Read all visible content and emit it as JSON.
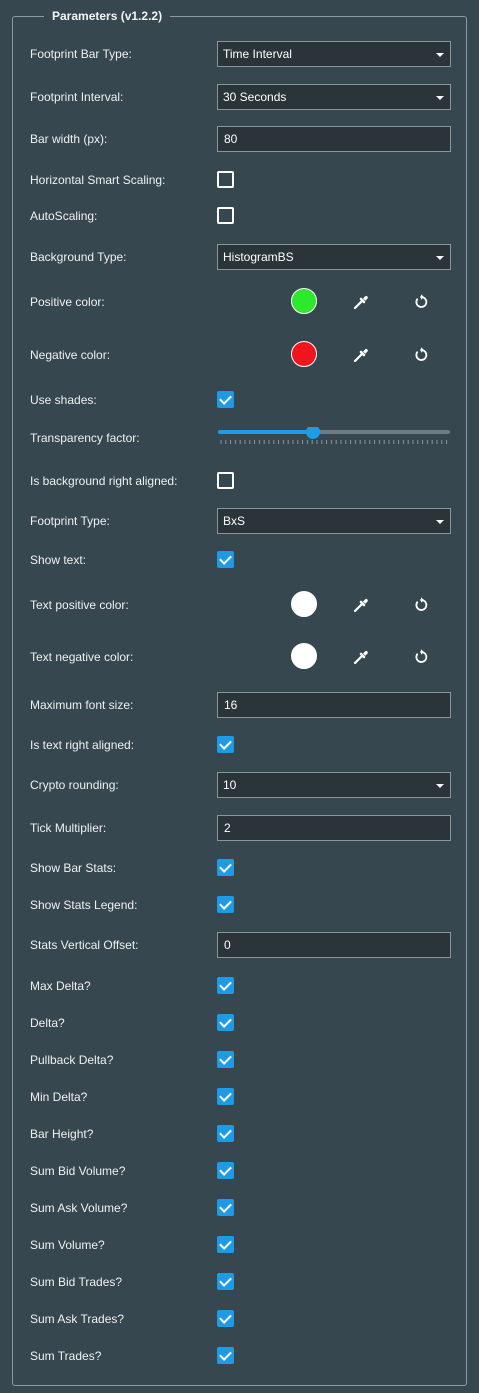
{
  "panel": {
    "title": "Parameters (v1.2.2)"
  },
  "fields": [
    {
      "label": "Footprint Bar Type:",
      "type": "select",
      "value": "Time Interval"
    },
    {
      "label": "Footprint Interval:",
      "type": "select",
      "value": "30 Seconds"
    },
    {
      "label": "Bar width (px):",
      "type": "input",
      "value": "80"
    },
    {
      "label": "Horizontal Smart Scaling:",
      "type": "checkbox",
      "checked": false
    },
    {
      "label": "AutoScaling:",
      "type": "checkbox",
      "checked": false
    },
    {
      "label": "Background Type:",
      "type": "select",
      "value": "HistogramBS"
    },
    {
      "label": "Positive color:",
      "type": "color",
      "color": "#2ee82e"
    },
    {
      "label": "Negative color:",
      "type": "color",
      "color": "#f0141e"
    },
    {
      "label": "Use shades:",
      "type": "checkbox",
      "checked": true
    },
    {
      "label": "Transparency factor:",
      "type": "slider",
      "value": 0.41
    },
    {
      "label": "Is background right aligned:",
      "type": "checkbox",
      "checked": false
    },
    {
      "label": "Footprint Type:",
      "type": "select",
      "value": "BxS"
    },
    {
      "label": "Show text:",
      "type": "checkbox",
      "checked": true
    },
    {
      "label": "Text positive color:",
      "type": "color",
      "color": "#ffffff"
    },
    {
      "label": "Text negative color:",
      "type": "color",
      "color": "#ffffff"
    },
    {
      "label": "Maximum font size:",
      "type": "input",
      "value": "16"
    },
    {
      "label": "Is text right aligned:",
      "type": "checkbox",
      "checked": true
    },
    {
      "label": "Crypto rounding:",
      "type": "select",
      "value": "10"
    },
    {
      "label": "Tick Multiplier:",
      "type": "input",
      "value": "2"
    },
    {
      "label": "Show Bar Stats:",
      "type": "checkbox",
      "checked": true
    },
    {
      "label": "Show Stats Legend:",
      "type": "checkbox",
      "checked": true
    },
    {
      "label": "Stats Vertical Offset:",
      "type": "input",
      "value": "0"
    },
    {
      "label": "Max Delta?",
      "type": "checkbox",
      "checked": true
    },
    {
      "label": "Delta?",
      "type": "checkbox",
      "checked": true
    },
    {
      "label": "Pullback Delta?",
      "type": "checkbox",
      "checked": true
    },
    {
      "label": "Min Delta?",
      "type": "checkbox",
      "checked": true
    },
    {
      "label": "Bar Height?",
      "type": "checkbox",
      "checked": true
    },
    {
      "label": "Sum Bid Volume?",
      "type": "checkbox",
      "checked": true
    },
    {
      "label": "Sum Ask Volume?",
      "type": "checkbox",
      "checked": true
    },
    {
      "label": "Sum Volume?",
      "type": "checkbox",
      "checked": true
    },
    {
      "label": "Sum Bid Trades?",
      "type": "checkbox",
      "checked": true
    },
    {
      "label": "Sum Ask Trades?",
      "type": "checkbox",
      "checked": true
    },
    {
      "label": "Sum Trades?",
      "type": "checkbox",
      "checked": true
    }
  ],
  "icons": {
    "picker": "eyedropper-icon",
    "reset": "reset-icon"
  },
  "colors": {
    "background": "#37474f",
    "accent": "#1e9be6",
    "border": "#8d9aa0"
  }
}
